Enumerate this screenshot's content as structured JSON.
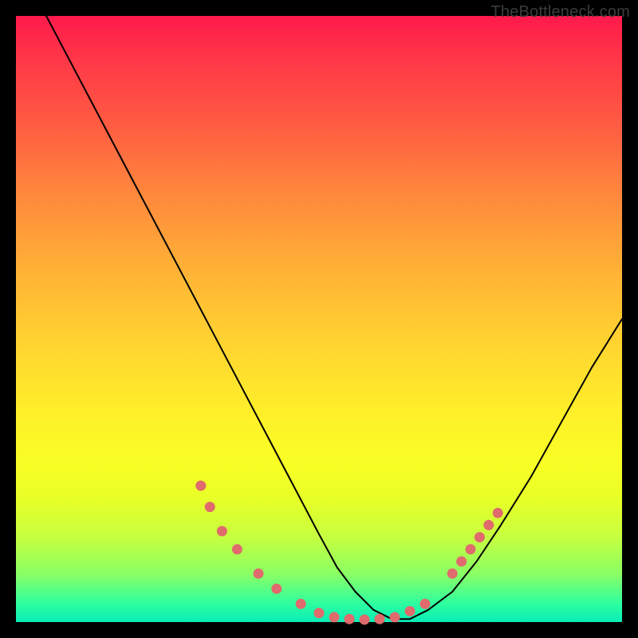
{
  "watermark": "TheBottleneck.com",
  "chart_data": {
    "type": "line",
    "title": "",
    "xlabel": "",
    "ylabel": "",
    "xlim": [
      0,
      100
    ],
    "ylim": [
      0,
      100
    ],
    "series": [
      {
        "name": "bottleneck-curve",
        "x": [
          5,
          10,
          15,
          20,
          25,
          30,
          35,
          40,
          45,
          50,
          53,
          56,
          59,
          62,
          65,
          68,
          72,
          76,
          80,
          85,
          90,
          95,
          100
        ],
        "y": [
          100,
          90.5,
          81,
          71.5,
          62,
          52.5,
          43,
          33.5,
          24,
          14.5,
          9,
          5,
          2,
          0.5,
          0.5,
          2,
          5,
          10,
          16,
          24,
          33,
          42,
          50
        ]
      }
    ],
    "markers": {
      "name": "salmon-dots",
      "color": "#e06a6c",
      "points": [
        {
          "x": 30.5,
          "y": 22.5
        },
        {
          "x": 32,
          "y": 19
        },
        {
          "x": 34,
          "y": 15
        },
        {
          "x": 36.5,
          "y": 12
        },
        {
          "x": 40,
          "y": 8
        },
        {
          "x": 43,
          "y": 5.5
        },
        {
          "x": 47,
          "y": 3
        },
        {
          "x": 50,
          "y": 1.5
        },
        {
          "x": 52.5,
          "y": 0.8
        },
        {
          "x": 55,
          "y": 0.5
        },
        {
          "x": 57.5,
          "y": 0.4
        },
        {
          "x": 60,
          "y": 0.5
        },
        {
          "x": 62.5,
          "y": 0.8
        },
        {
          "x": 65,
          "y": 1.8
        },
        {
          "x": 67.5,
          "y": 3
        },
        {
          "x": 72,
          "y": 8
        },
        {
          "x": 73.5,
          "y": 10
        },
        {
          "x": 75,
          "y": 12
        },
        {
          "x": 76.5,
          "y": 14
        },
        {
          "x": 78,
          "y": 16
        },
        {
          "x": 79.5,
          "y": 18
        }
      ]
    },
    "colors": {
      "frame_bg": "#000000",
      "curve": "#000000",
      "marker": "#e06a6c",
      "gradient_top": "#ff1a4c",
      "gradient_bottom": "#09ecb6"
    }
  }
}
